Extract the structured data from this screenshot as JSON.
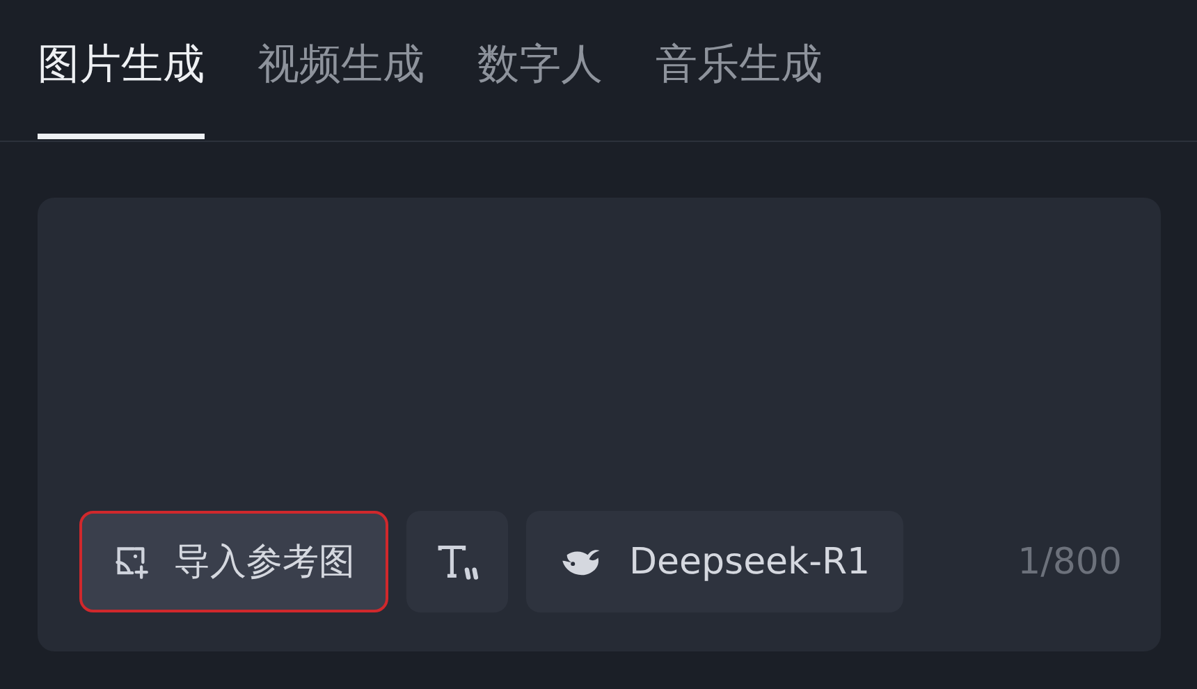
{
  "tabs": [
    {
      "label": "图片生成",
      "selected": true
    },
    {
      "label": "视频生成",
      "selected": false
    },
    {
      "label": "数字人",
      "selected": false
    },
    {
      "label": "音乐生成",
      "selected": false
    }
  ],
  "composer": {
    "tools": [
      {
        "kind": "import",
        "label": "导入参考图",
        "highlighted": true
      },
      {
        "kind": "text-style",
        "highlighted": false
      },
      {
        "kind": "model",
        "label": "Deepseek-R1",
        "highlighted": false
      }
    ],
    "counter": "1/800"
  }
}
